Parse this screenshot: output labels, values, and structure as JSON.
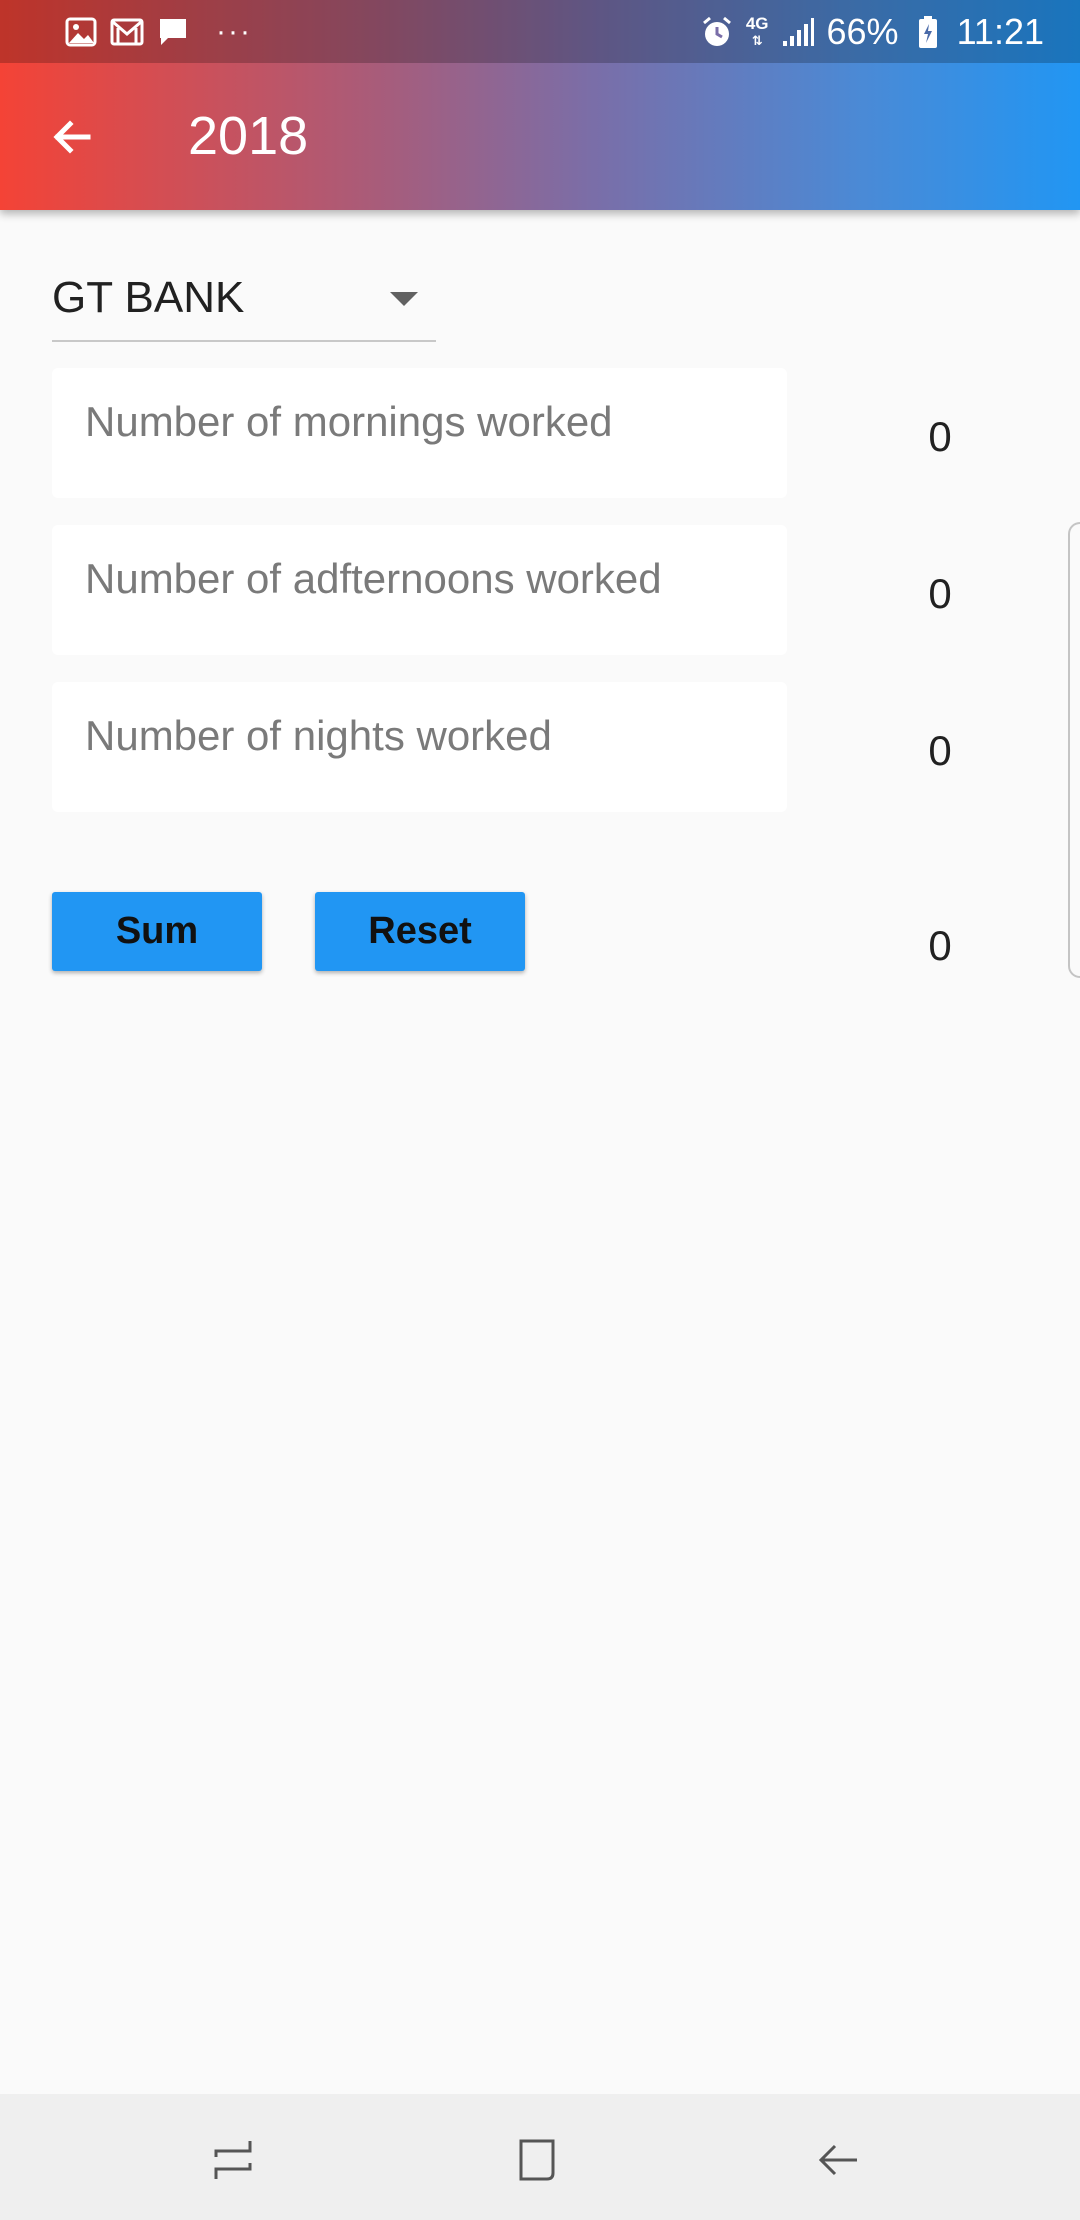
{
  "status_bar": {
    "icons_left": [
      "image-icon",
      "gmail-icon",
      "message-icon"
    ],
    "more_dots": "···",
    "network": "4G",
    "battery": "66%",
    "time": "11:21",
    "icons_right": [
      "alarm-icon",
      "network-4g-icon",
      "signal-icon",
      "battery-charging-icon"
    ]
  },
  "app_bar": {
    "title": "2018",
    "back_icon": "arrow-left-icon",
    "gradient": [
      "#f44336",
      "#2196f3"
    ]
  },
  "form": {
    "bank_select": {
      "value": "GT BANK"
    },
    "fields": [
      {
        "placeholder": "Number of mornings worked",
        "value": ""
      },
      {
        "placeholder": "Number of adfternoons worked",
        "value": ""
      },
      {
        "placeholder": "Number of nights worked",
        "value": ""
      }
    ],
    "results": [
      "0",
      "0",
      "0"
    ],
    "total": "0",
    "sum_label": "Sum",
    "reset_label": "Reset",
    "button_color": "#2196f3"
  },
  "nav_bar": {
    "icons": [
      "recent-apps-icon",
      "home-icon",
      "back-icon"
    ]
  }
}
